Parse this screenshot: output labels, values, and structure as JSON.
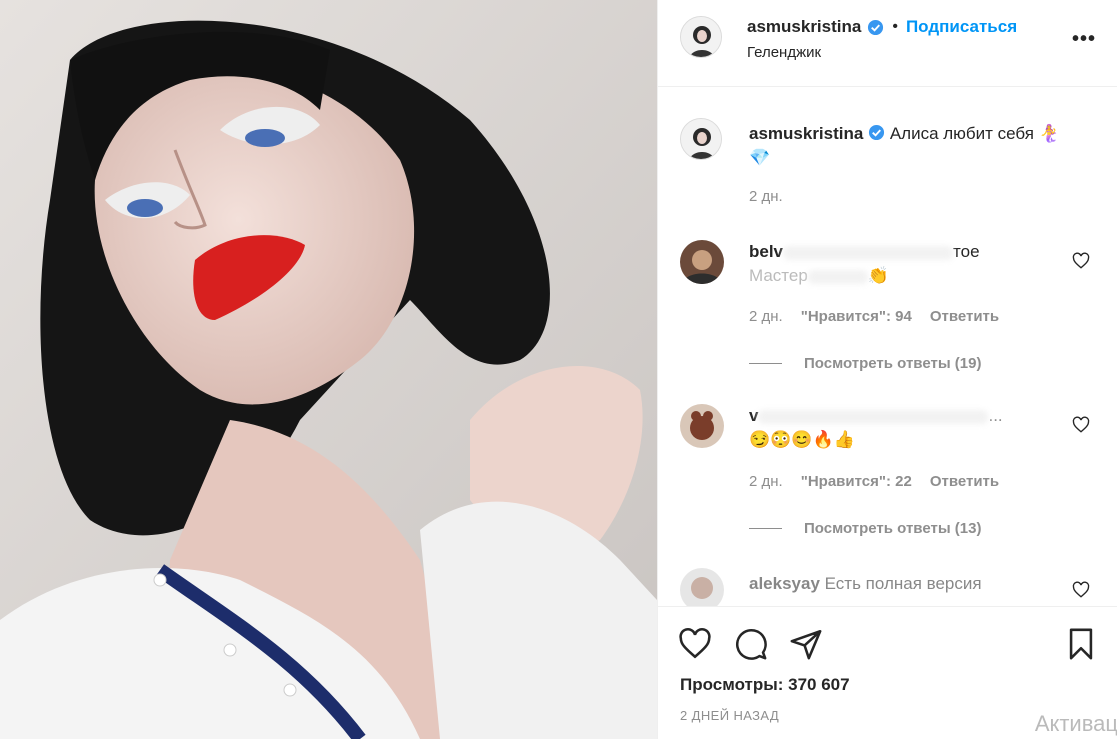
{
  "header": {
    "username": "asmuskristina",
    "separator": "•",
    "follow_label": "Подписаться",
    "location": "Гелeнджик",
    "more_label": "•••"
  },
  "caption": {
    "username": "asmuskristina",
    "text": "Алиса любит себя 🧜‍♀️",
    "text2": "💎",
    "time": "2 дн."
  },
  "comments": [
    {
      "username_partial": "belv",
      "text_tail": "тое",
      "text_line2_partial": "Мастер",
      "emoji": "👏",
      "time": "2 дн.",
      "likes": "\"Нравится\": 94",
      "reply_label": "Ответить",
      "view_replies": "Посмотреть ответы (19)"
    },
    {
      "username_partial": "v",
      "text_tail": "...",
      "emoji_line": "😏😳😊🔥👍",
      "time": "2 дн.",
      "likes": "\"Нравится\": 22",
      "reply_label": "Ответить",
      "view_replies": "Посмотреть ответы (13)"
    },
    {
      "username": "aleksyay",
      "text": "Есть полная версия"
    }
  ],
  "actions": {
    "views": "Просмотры: 370 607",
    "posted": "2 ДНЕЙ НАЗАД"
  },
  "watermark": "Активац",
  "colors": {
    "accent": "#0095f6",
    "text": "#262626",
    "muted": "#8e8e8e",
    "lips": "#d8201f"
  },
  "icons": [
    "heart-icon",
    "comment-icon",
    "share-icon",
    "bookmark-icon",
    "verified-icon",
    "more-icon"
  ]
}
